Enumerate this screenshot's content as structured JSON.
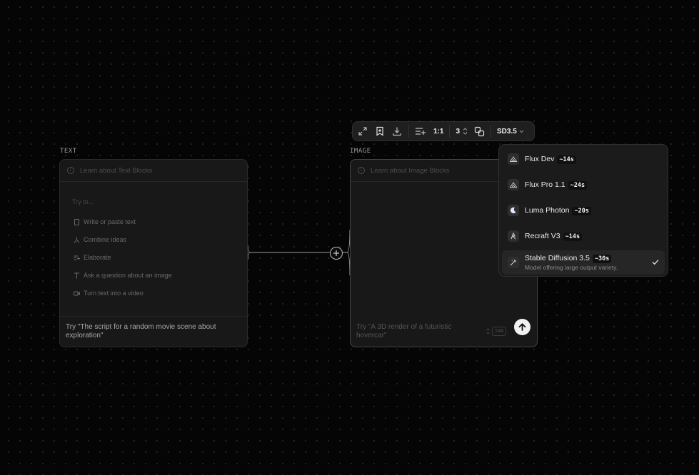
{
  "text_block": {
    "title": "TEXT",
    "learn": "Learn about Text Blocks",
    "suggest_label": "Try to...",
    "options": [
      {
        "label": "Write or paste text",
        "icon": "document-icon"
      },
      {
        "label": "Combine ideas",
        "icon": "merge-icon"
      },
      {
        "label": "Elaborate",
        "icon": "lines-plus-icon"
      },
      {
        "label": "Ask a question about an image",
        "icon": "text-cursor-icon"
      },
      {
        "label": "Turn text into a video",
        "icon": "video-icon"
      }
    ],
    "prompt": "Try \"The script for a random movie scene about exploration\""
  },
  "image_block": {
    "title": "IMAGE",
    "learn": "Learn about Image Blocks",
    "placeholder": "Try \"A 3D render of a futuristic hovercar\"",
    "tab_label": "TAB"
  },
  "toolbar": {
    "aspect": "1:1",
    "count": "3",
    "model": "SD3.5"
  },
  "models": [
    {
      "name": "Flux Dev",
      "time": "~14s",
      "description": "",
      "selected": false
    },
    {
      "name": "Flux Pro 1.1",
      "time": "~24s",
      "description": "",
      "selected": false
    },
    {
      "name": "Luma Photon",
      "time": "~20s",
      "description": "",
      "selected": false
    },
    {
      "name": "Recraft V3",
      "time": "~14s",
      "description": "",
      "selected": false
    },
    {
      "name": "Stable Diffusion 3.5",
      "time": "~30s",
      "description": "Model offering large output variety.",
      "selected": true
    }
  ],
  "colors": {
    "background": "#050505",
    "card": "#181818",
    "accent": "#ffffff"
  }
}
